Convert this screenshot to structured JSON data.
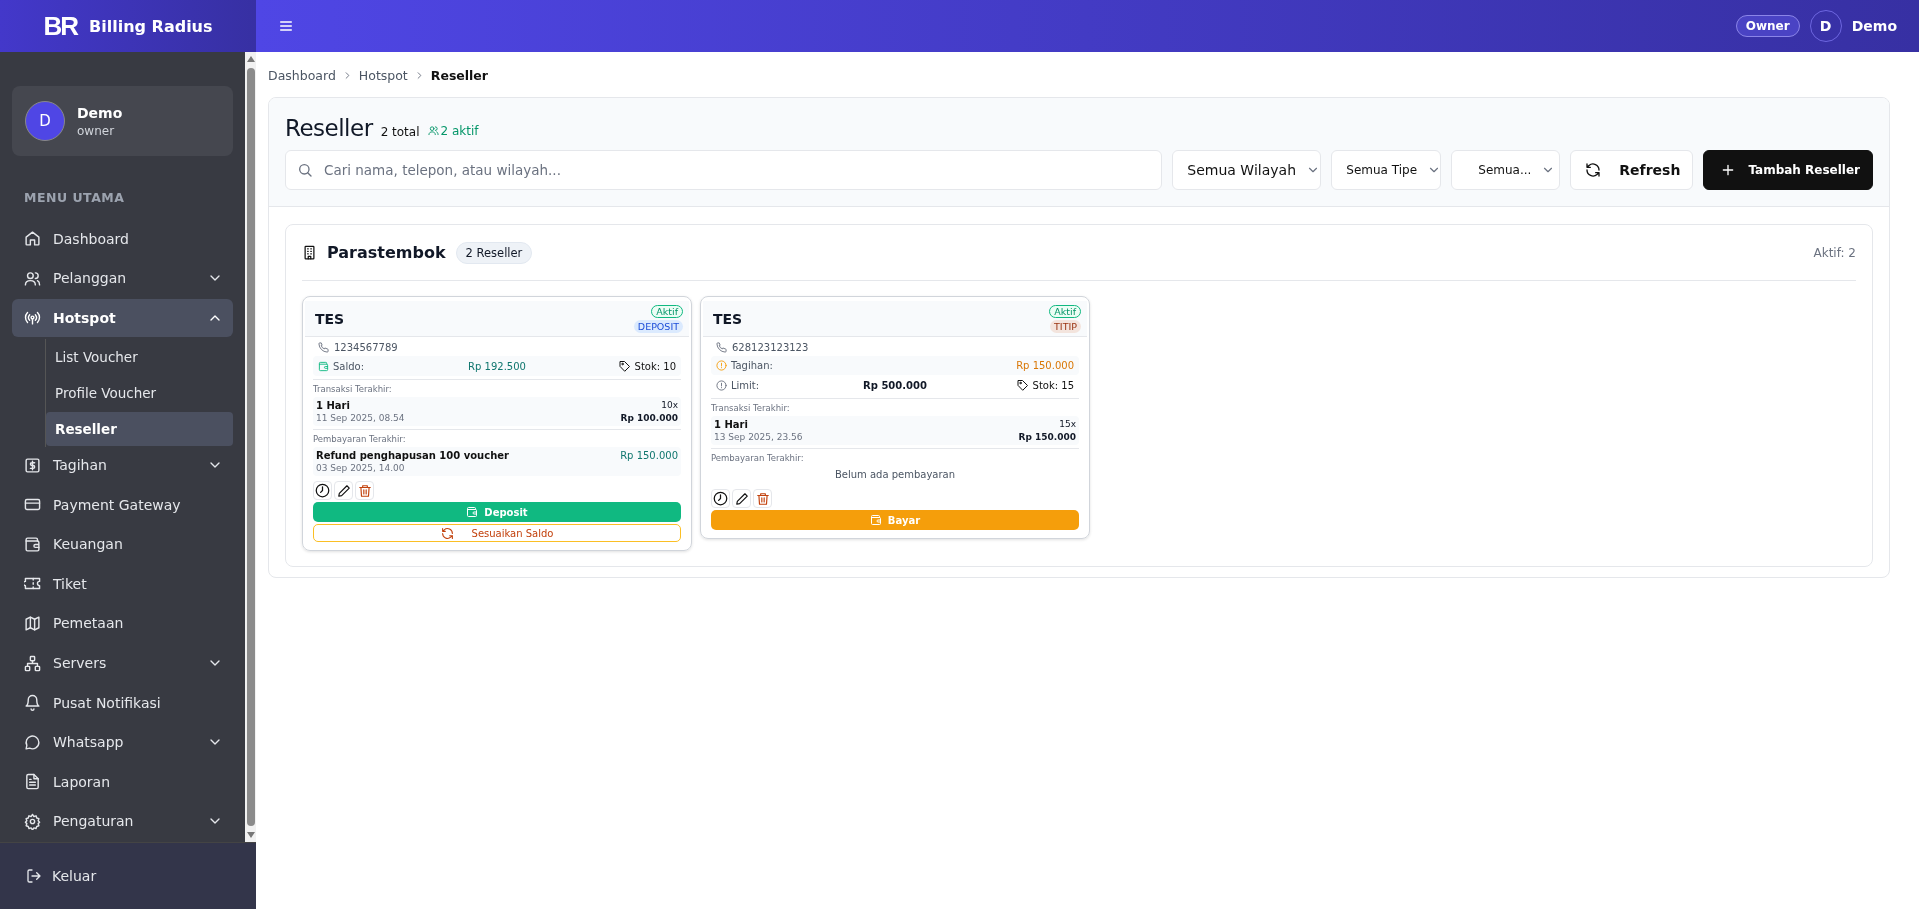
{
  "sidebar": {
    "brand": {
      "logo": "BR",
      "name": "Billing Radius"
    },
    "user": {
      "initial": "D",
      "name": "Demo",
      "role": "owner"
    },
    "section_title": "MENU UTAMA",
    "items": [
      {
        "label": "Dashboard",
        "selected": false
      },
      {
        "label": "Pelanggan",
        "selected": false,
        "expanded": false
      },
      {
        "label": "Hotspot",
        "selected": true,
        "expanded": true,
        "children": [
          {
            "label": "List Voucher",
            "selected": false
          },
          {
            "label": "Profile Voucher",
            "selected": false
          },
          {
            "label": "Reseller",
            "selected": true
          }
        ]
      },
      {
        "label": "Tagihan",
        "selected": false,
        "expanded": false
      },
      {
        "label": "Payment Gateway",
        "selected": false
      },
      {
        "label": "Keuangan",
        "selected": false
      },
      {
        "label": "Tiket",
        "selected": false
      },
      {
        "label": "Pemetaan",
        "selected": false
      },
      {
        "label": "Servers",
        "selected": false,
        "expanded": false
      },
      {
        "label": "Pusat Notifikasi",
        "selected": false
      },
      {
        "label": "Whatsapp",
        "selected": false,
        "expanded": false
      },
      {
        "label": "Laporan",
        "selected": false
      },
      {
        "label": "Pengaturan",
        "selected": false,
        "expanded": false
      }
    ],
    "logout": "Keluar"
  },
  "topbar": {
    "role_badge": "Owner",
    "user_initial": "D",
    "user_name": "Demo"
  },
  "breadcrumb": [
    {
      "label": "Dashboard",
      "current": false
    },
    {
      "label": "Hotspot",
      "current": false
    },
    {
      "label": "Reseller",
      "current": true
    }
  ],
  "page": {
    "title": "Reseller",
    "total": "2 total",
    "active": "2 aktif",
    "search": {
      "placeholder": "Cari nama, telepon, atau wilayah..."
    },
    "filters": [
      "Semua Wilayah",
      "Semua Tipe",
      "Semua..."
    ],
    "refresh_button": "Refresh",
    "add_button": "Tambah Reseller"
  },
  "groups": [
    {
      "name": "Parastembok",
      "count": "2 Reseller",
      "active": "Aktif: 2",
      "resellers": [
        {
          "kind": "deposit",
          "name": "TES",
          "status": "Aktif",
          "type": "DEPOSIT",
          "phone": "1234567789",
          "rows": [
            {
              "kind": "balance",
              "label": "Saldo:",
              "value": "Rp 192.500",
              "stock": "Stok: 10"
            }
          ],
          "transactions_label": "Transaksi Terakhir:",
          "transaction": {
            "name": "1 Hari",
            "date": "11 Sep 2025, 08.54",
            "qty": "10x",
            "amount": "Rp 100.000"
          },
          "payments_label": "Pembayaran Terakhir:",
          "payment": {
            "description": "Refund penghapusan 100 voucher",
            "date": "03 Sep 2025, 14.00",
            "amount": "Rp 150.000"
          },
          "primary_action": "Deposit",
          "secondary_action": "Sesuaikan Saldo"
        },
        {
          "kind": "titip",
          "name": "TES",
          "status": "Aktif",
          "type": "TITIP",
          "phone": "628123123123",
          "rows": [
            {
              "kind": "bill",
              "label": "Tagihan:",
              "value": "Rp 150.000"
            },
            {
              "kind": "limit",
              "label": "Limit:",
              "value": "Rp 500.000",
              "stock": "Stok: 15"
            }
          ],
          "transactions_label": "Transaksi Terakhir:",
          "transaction": {
            "name": "1 Hari",
            "date": "13 Sep 2025, 23.56",
            "qty": "15x",
            "amount": "Rp 150.000"
          },
          "payments_label": "Pembayaran Terakhir:",
          "payment_empty": "Belum ada pembayaran",
          "primary_action": "Bayar"
        }
      ]
    }
  ]
}
